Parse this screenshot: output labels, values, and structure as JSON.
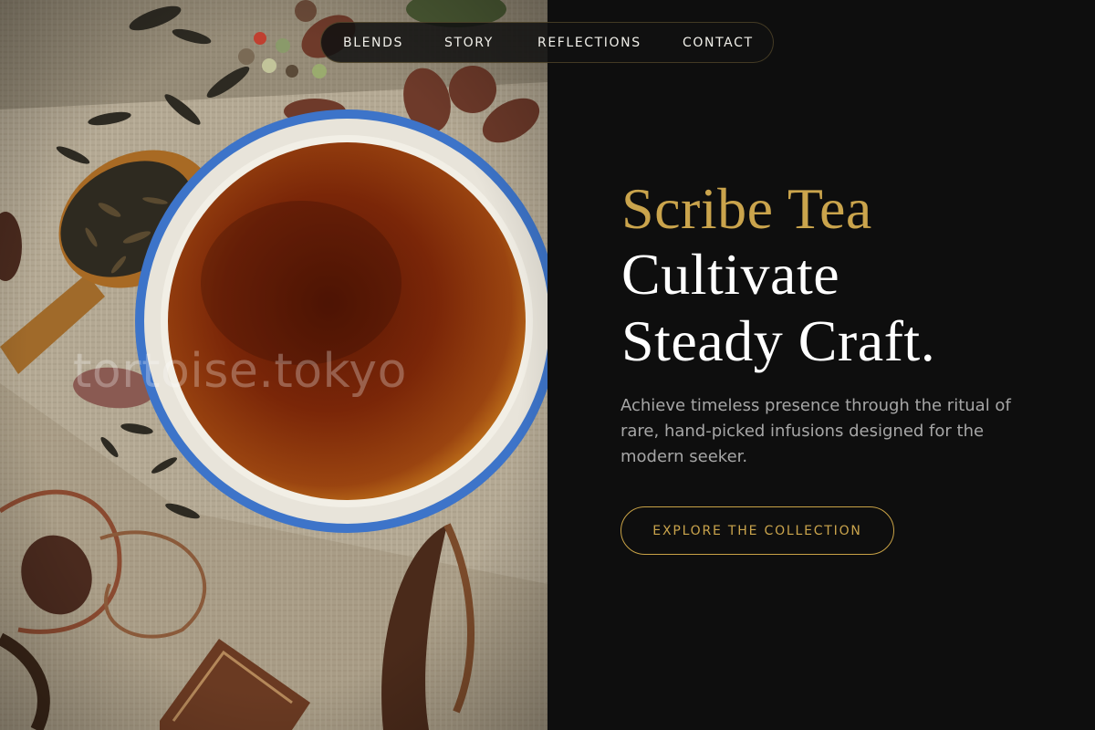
{
  "nav": {
    "items": [
      {
        "label": "BLENDS"
      },
      {
        "label": "STORY"
      },
      {
        "label": "REFLECTIONS"
      },
      {
        "label": "CONTACT"
      }
    ]
  },
  "hero": {
    "watermark": "tortoise.tokyo",
    "brand": "Scribe Tea",
    "headline_line1": "Cultivate",
    "headline_line2": "Steady Craft.",
    "description": "Achieve timeless presence through the ritual of rare, hand-picked infusions designed for the modern seeker.",
    "cta_label": "EXPLORE THE COLLECTION"
  },
  "colors": {
    "background": "#0e0e0e",
    "accent_gold": "#caa44c",
    "text_primary": "#ffffff",
    "text_muted": "#a6a6a6",
    "tea": "#7a2408",
    "cup_rim": "#3c74c8"
  }
}
